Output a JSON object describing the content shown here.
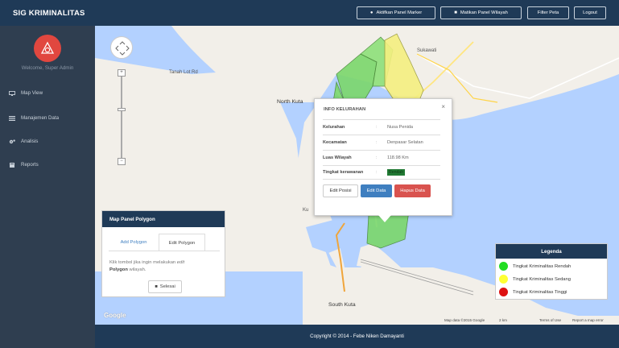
{
  "app": {
    "title": "SIG KRIMINALITAS"
  },
  "topbar": {
    "buttons": [
      {
        "label": "Aktifkan Panel Marker",
        "icon": "map-marker-icon"
      },
      {
        "label": "Matikan Panel Wilayah",
        "icon": "square-icon"
      },
      {
        "label": "Filter Peta",
        "icon": ""
      },
      {
        "label": "Logout",
        "icon": ""
      }
    ]
  },
  "sidebar": {
    "welcome": "Welcome, Super Admin",
    "items": [
      {
        "label": "Map View",
        "icon": "monitor-icon"
      },
      {
        "label": "Manajemen Data",
        "icon": "list-icon"
      },
      {
        "label": "Analisis",
        "icon": "gears-icon"
      },
      {
        "label": "Reports",
        "icon": "book-icon"
      }
    ]
  },
  "map": {
    "labels": {
      "north_kuta": "North Kuta",
      "sukawati": "Sukawati",
      "south_kuta": "South Kuta",
      "kuta": "Ku",
      "tanah": "Tanah Lot Rd"
    },
    "google": "Google",
    "attribution": [
      "Map data ©2015 Google",
      "2 km",
      "Terms of Use",
      "Report a map error"
    ]
  },
  "info_window": {
    "title": "INFO KELURAHAN",
    "rows": [
      {
        "key": "Kelurahan",
        "value": "Nusa Penida"
      },
      {
        "key": "Kecamatan",
        "value": "Denpasar Selatan"
      },
      {
        "key": "Luas Wilayah",
        "value": "118.98 Km"
      },
      {
        "key": "Tingkat kerawanan",
        "value": "Rendah"
      }
    ],
    "buttons": {
      "edit_posisi": "Edit Posisi",
      "edit_data": "Edit Data",
      "hapus_data": "Hapus Data"
    }
  },
  "polygon_panel": {
    "title": "Map Panel Polygon",
    "tabs": [
      "Add Polygon",
      "Edit Polygon"
    ],
    "text_pre": "Klik tombol jika ingin melakukan ",
    "text_em": "edit",
    "text_strong": "Polygon",
    "text_post": " wilayah.",
    "done_label": "Selesai"
  },
  "legend": {
    "title": "Legenda",
    "items": [
      {
        "label": "Tingkat Kriminalitas Rendah",
        "color": "#22dd22"
      },
      {
        "label": "Tingkat Kriminalitas Sedang",
        "color": "#ffff33"
      },
      {
        "label": "Tingkat Kriminalitas Tinggi",
        "color": "#dd1111"
      }
    ]
  },
  "footer": {
    "text": "Copyright © 2014 - Febe Niken Damayanti"
  },
  "colors": {
    "navy": "#1f3a57",
    "sidebar": "#2f3e50",
    "accent_red": "#e1473f",
    "btn_blue": "#3f7fc0",
    "btn_red": "#d9534f"
  }
}
